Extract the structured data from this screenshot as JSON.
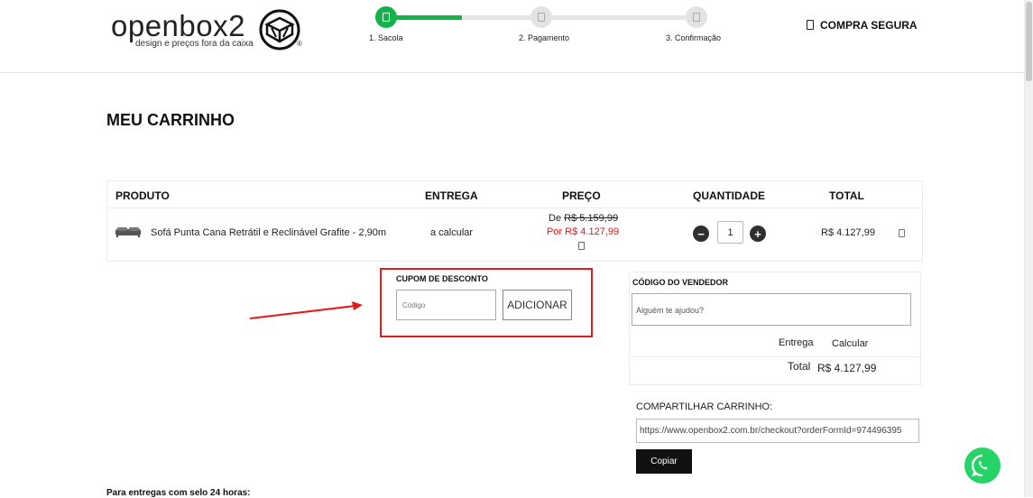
{
  "header": {
    "logo_text": "openbox2",
    "logo_tagline": "design e preços fora da caixa",
    "logo_reg": "®",
    "steps": [
      {
        "label": "1. Sacola",
        "state": "active"
      },
      {
        "label": "2. Pagamento",
        "state": "pending"
      },
      {
        "label": "3. Confirmação",
        "state": "pending"
      }
    ],
    "secure_label": "COMPRA SEGURA",
    "secure_icon": "lock-icon"
  },
  "page_title": "MEU CARRINHO",
  "cart": {
    "columns": {
      "product": "PRODUTO",
      "delivery": "ENTREGA",
      "price": "PREÇO",
      "quantity": "QUANTIDADE",
      "total": "TOTAL"
    },
    "items": [
      {
        "name": "Sofá Punta Cana Retrátil e Reclinável Grafite - 2,90m",
        "delivery": "a calcular",
        "price_from_prefix": "De",
        "price_from": "R$ 5.159,99",
        "price_to": "Por R$ 4.127,99",
        "quantity": "1",
        "total": "R$ 4.127,99"
      }
    ],
    "qty_minus": "−",
    "qty_plus": "+"
  },
  "coupon": {
    "title": "CUPOM DE DESCONTO",
    "placeholder": "Código",
    "button": "ADICIONAR",
    "highlight_color": "#e21b1b"
  },
  "summary": {
    "seller_title": "CÓDIGO DO VENDEDOR",
    "seller_placeholder": "Alguém te ajudou?",
    "shipping_label": "Entrega",
    "shipping_value": "Calcular",
    "total_label": "Total",
    "total_value": "R$ 4.127,99"
  },
  "share": {
    "title": "COMPARTILHAR CARRINHO:",
    "url": "https://www.openbox2.com.br/checkout?orderFormId=974496395",
    "copy_button": "Copiar"
  },
  "footer_note": "Para entregas com selo 24 horas:",
  "colors": {
    "accent_green": "#13b24a",
    "price_red": "#e3161b",
    "whatsapp": "#25d366"
  }
}
